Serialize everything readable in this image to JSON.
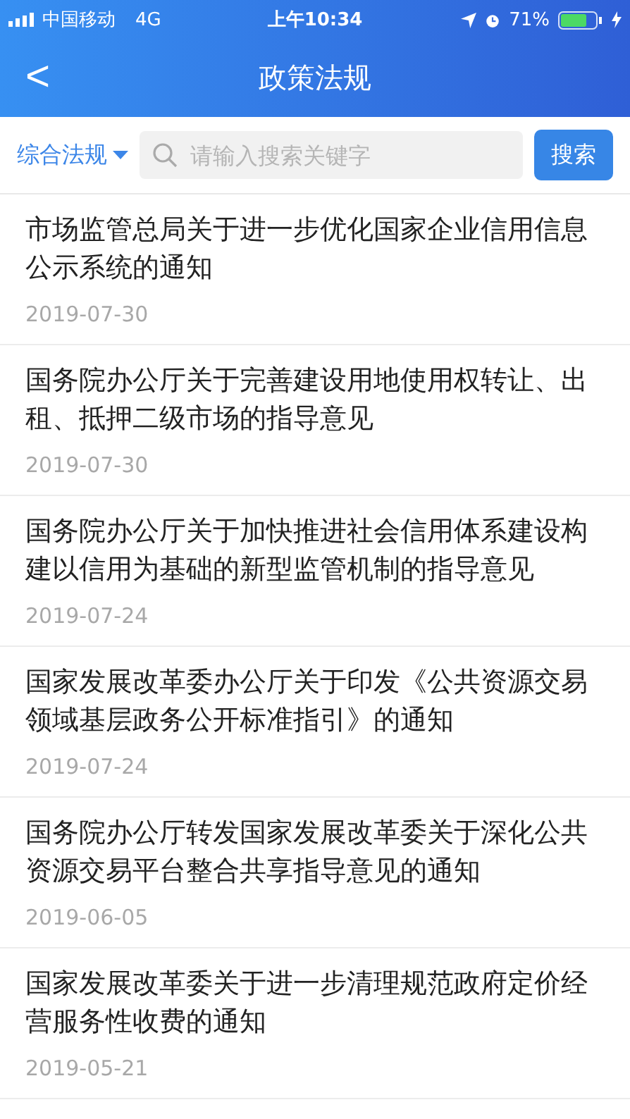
{
  "status_bar": {
    "carrier": "中国移动",
    "network": "4G",
    "time": "上午10:34",
    "battery": "71%"
  },
  "nav": {
    "back": "<",
    "title": "政策法规"
  },
  "filter": {
    "category": "综合法规",
    "placeholder": "请输入搜索关键字",
    "search_button": "搜索"
  },
  "articles": [
    {
      "title": "市场监管总局关于进一步优化国家企业信用信息公示系统的通知",
      "date": "2019-07-30"
    },
    {
      "title": "国务院办公厅关于完善建设用地使用权转让、出租、抵押二级市场的指导意见",
      "date": "2019-07-30"
    },
    {
      "title": "国务院办公厅关于加快推进社会信用体系建设构建以信用为基础的新型监管机制的指导意见",
      "date": "2019-07-24"
    },
    {
      "title": "国家发展改革委办公厅关于印发《公共资源交易领域基层政务公开标准指引》的通知",
      "date": "2019-07-24"
    },
    {
      "title": "国务院办公厅转发国家发展改革委关于深化公共资源交易平台整合共享指导意见的通知",
      "date": "2019-06-05"
    },
    {
      "title": "国家发展改革委关于进一步清理规范政府定价经营服务性收费的通知",
      "date": "2019-05-21"
    }
  ]
}
